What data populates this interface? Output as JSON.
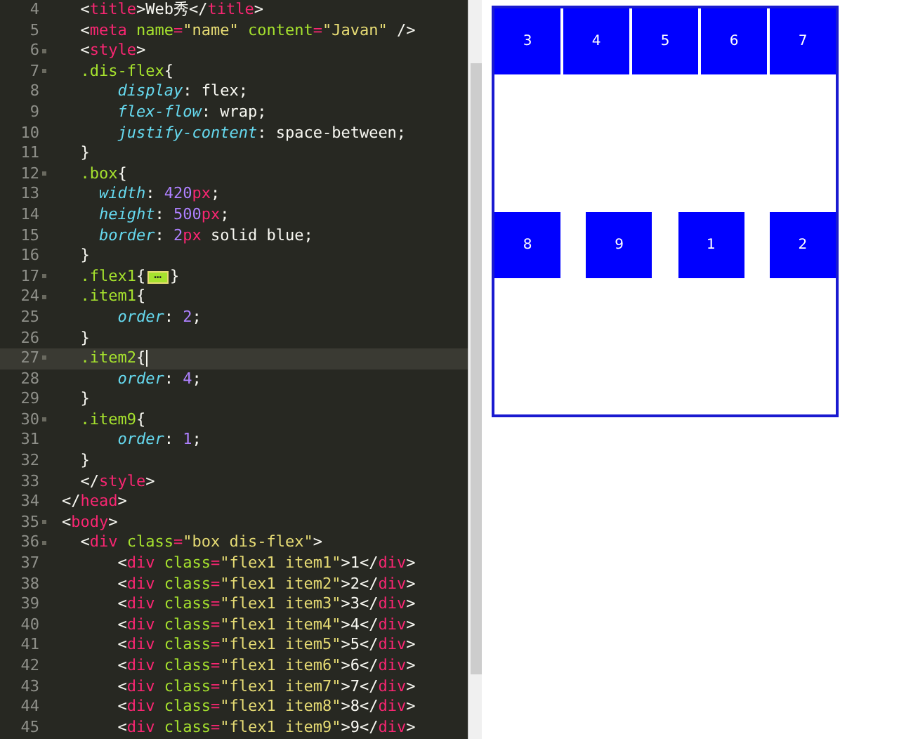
{
  "editor": {
    "lines": [
      {
        "number": "4",
        "kind": "html",
        "foldable": false,
        "current": false,
        "text": "  <title>Web秀</title>"
      },
      {
        "number": "5",
        "kind": "html",
        "foldable": false,
        "current": false,
        "text": "  <meta name=\"name\" content=\"Javan\" />"
      },
      {
        "number": "6",
        "kind": "html",
        "foldable": true,
        "current": false,
        "text": "  <style>"
      },
      {
        "number": "7",
        "kind": "css",
        "foldable": true,
        "current": false,
        "text": "  .dis-flex{"
      },
      {
        "number": "8",
        "kind": "css",
        "foldable": false,
        "current": false,
        "text": "      display: flex;"
      },
      {
        "number": "9",
        "kind": "css",
        "foldable": false,
        "current": false,
        "text": "      flex-flow: wrap;"
      },
      {
        "number": "10",
        "kind": "css",
        "foldable": false,
        "current": false,
        "text": "      justify-content: space-between;"
      },
      {
        "number": "11",
        "kind": "css",
        "foldable": false,
        "current": false,
        "text": "  }"
      },
      {
        "number": "12",
        "kind": "css",
        "foldable": true,
        "current": false,
        "text": "  .box{"
      },
      {
        "number": "13",
        "kind": "css",
        "foldable": false,
        "current": false,
        "text": "    width: 420px;"
      },
      {
        "number": "14",
        "kind": "css",
        "foldable": false,
        "current": false,
        "text": "    height: 500px;"
      },
      {
        "number": "15",
        "kind": "css",
        "foldable": false,
        "current": false,
        "text": "    border: 2px solid blue;"
      },
      {
        "number": "16",
        "kind": "css",
        "foldable": false,
        "current": false,
        "text": "  }"
      },
      {
        "number": "17",
        "kind": "css",
        "foldable": true,
        "current": false,
        "text": "  .flex1{",
        "fold": "…",
        "text_after": "}"
      },
      {
        "number": "24",
        "kind": "css",
        "foldable": true,
        "current": false,
        "text": "  .item1{"
      },
      {
        "number": "25",
        "kind": "css",
        "foldable": false,
        "current": false,
        "text": "      order: 2;"
      },
      {
        "number": "26",
        "kind": "css",
        "foldable": false,
        "current": false,
        "text": "  }"
      },
      {
        "number": "27",
        "kind": "css",
        "foldable": true,
        "current": true,
        "text": "  .item2{"
      },
      {
        "number": "28",
        "kind": "css",
        "foldable": false,
        "current": false,
        "text": "      order: 4;"
      },
      {
        "number": "29",
        "kind": "css",
        "foldable": false,
        "current": false,
        "text": "  }"
      },
      {
        "number": "30",
        "kind": "css",
        "foldable": true,
        "current": false,
        "text": "  .item9{"
      },
      {
        "number": "31",
        "kind": "css",
        "foldable": false,
        "current": false,
        "text": "      order: 1;"
      },
      {
        "number": "32",
        "kind": "css",
        "foldable": false,
        "current": false,
        "text": "  }"
      },
      {
        "number": "33",
        "kind": "html",
        "foldable": false,
        "current": false,
        "text": "  </style>"
      },
      {
        "number": "34",
        "kind": "html",
        "foldable": false,
        "current": false,
        "text": "</head>"
      },
      {
        "number": "35",
        "kind": "html",
        "foldable": true,
        "current": false,
        "text": "<body>"
      },
      {
        "number": "36",
        "kind": "html",
        "foldable": true,
        "current": false,
        "text": "  <div class=\"box dis-flex\">"
      },
      {
        "number": "37",
        "kind": "html",
        "foldable": false,
        "current": false,
        "text": "      <div class=\"flex1 item1\">1</div>"
      },
      {
        "number": "38",
        "kind": "html",
        "foldable": false,
        "current": false,
        "text": "      <div class=\"flex1 item2\">2</div>"
      },
      {
        "number": "39",
        "kind": "html",
        "foldable": false,
        "current": false,
        "text": "      <div class=\"flex1 item3\">3</div>"
      },
      {
        "number": "40",
        "kind": "html",
        "foldable": false,
        "current": false,
        "text": "      <div class=\"flex1 item4\">4</div>"
      },
      {
        "number": "41",
        "kind": "html",
        "foldable": false,
        "current": false,
        "text": "      <div class=\"flex1 item5\">5</div>"
      },
      {
        "number": "42",
        "kind": "html",
        "foldable": false,
        "current": false,
        "text": "      <div class=\"flex1 item6\">6</div>"
      },
      {
        "number": "43",
        "kind": "html",
        "foldable": false,
        "current": false,
        "text": "      <div class=\"flex1 item7\">7</div>"
      },
      {
        "number": "44",
        "kind": "html",
        "foldable": false,
        "current": false,
        "text": "      <div class=\"flex1 item8\">8</div>"
      },
      {
        "number": "45",
        "kind": "html",
        "foldable": false,
        "current": false,
        "text": "      <div class=\"flex1 item9\">9</div>"
      }
    ]
  },
  "preview": {
    "items": [
      "3",
      "4",
      "5",
      "6",
      "7",
      "8",
      "9",
      "1",
      "2"
    ]
  }
}
